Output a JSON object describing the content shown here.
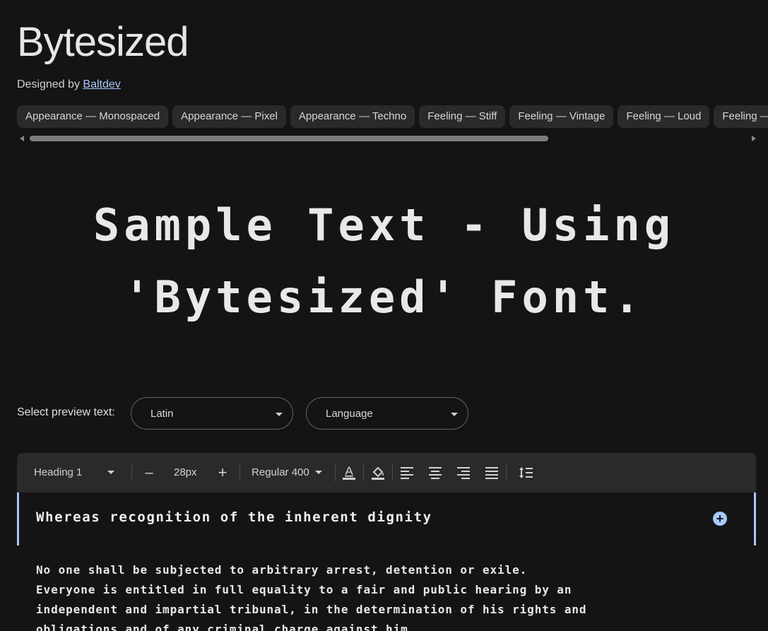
{
  "font": {
    "title": "Bytesized",
    "designed_by_prefix": "Designed by",
    "designer": "Baltdev"
  },
  "tags": [
    "Appearance — Monospaced",
    "Appearance — Pixel",
    "Appearance — Techno",
    "Feeling — Stiff",
    "Feeling — Vintage",
    "Feeling — Loud",
    "Feeling — Playful"
  ],
  "sample": {
    "line1": "Sample Text - Using",
    "line2": "'Bytesized' Font."
  },
  "preview": {
    "label": "Select preview text:",
    "script_value": "Latin",
    "language_value": "Language"
  },
  "toolbar": {
    "style": "Heading 1",
    "size": "28px",
    "weight": "Regular 400",
    "minus": "–",
    "plus": "+"
  },
  "editor": {
    "heading": "Whereas recognition of the inherent dignity",
    "add_icon": "plus-circle-icon",
    "paragraph_lines": [
      "No one shall be subjected to arbitrary arrest, detention or exile.",
      "Everyone is entitled in full equality to a fair and public hearing by an",
      "independent and impartial tribunal, in the determination of his rights and",
      "obligations and of any criminal charge against him."
    ]
  },
  "colors": {
    "background": "#141414",
    "accent": "#a8c7fa",
    "chip": "#2a2a2a"
  }
}
